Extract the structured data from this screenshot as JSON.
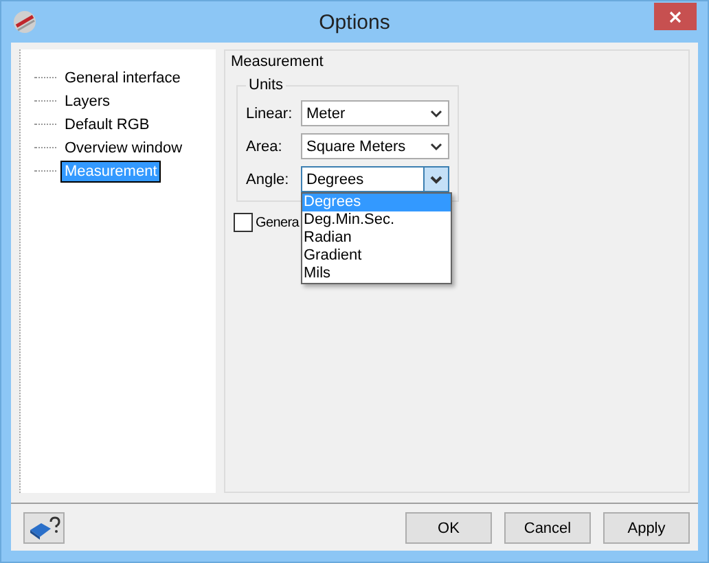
{
  "window": {
    "title": "Options"
  },
  "tree": {
    "items": [
      {
        "label": "General interface",
        "selected": false
      },
      {
        "label": "Layers",
        "selected": false
      },
      {
        "label": "Default RGB",
        "selected": false
      },
      {
        "label": "Overview window",
        "selected": false
      },
      {
        "label": "Measurement",
        "selected": true
      }
    ]
  },
  "section": {
    "title": "Measurement",
    "units": {
      "title": "Units",
      "fields": [
        {
          "label": "Linear:",
          "value": "Meter",
          "open": false
        },
        {
          "label": "Area:",
          "value": "Square Meters",
          "open": false
        },
        {
          "label": "Angle:",
          "value": "Degrees",
          "open": true,
          "options": [
            {
              "label": "Degrees",
              "selected": true
            },
            {
              "label": "Deg.Min.Sec.",
              "selected": false
            },
            {
              "label": "Radian",
              "selected": false
            },
            {
              "label": "Gradient",
              "selected": false
            },
            {
              "label": "Mils",
              "selected": false
            }
          ]
        }
      ]
    },
    "checkbox": {
      "label": "Genera",
      "checked": false
    }
  },
  "buttons": [
    {
      "label": "OK"
    },
    {
      "label": "Cancel"
    },
    {
      "label": "Apply"
    }
  ]
}
